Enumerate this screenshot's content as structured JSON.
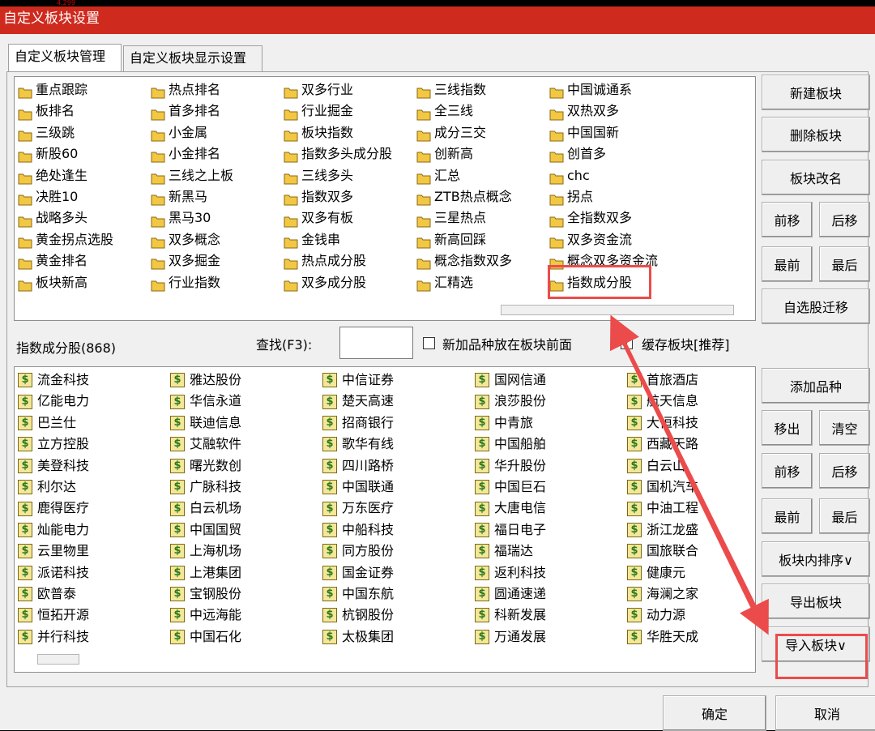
{
  "window": {
    "title": "自定义板块设置",
    "top_readout": "4,299"
  },
  "tabs": [
    {
      "label": "自定义板块管理",
      "active": true
    },
    {
      "label": "自定义板块显示设置",
      "active": false
    }
  ],
  "blocks": {
    "items": [
      "重点跟踪",
      "热点排名",
      "双多行业",
      "三线指数",
      "中国诚通系",
      "板排名",
      "首多排名",
      "行业掘金",
      "全三线",
      "双热双多",
      "三级跳",
      "小金属",
      "板块指数",
      "成分三交",
      "中国国新",
      "新股60",
      "小金排名",
      "指数多头成分股",
      "创新高",
      "创首多",
      "绝处逢生",
      "三线之上板",
      "三线多头",
      "汇总",
      "chc",
      "决胜10",
      "新黑马",
      "指数双多",
      "ZTB热点概念",
      "拐点",
      "战略多头",
      "黑马30",
      "双多有板",
      "三星热点",
      "全指数双多",
      "黄金拐点选股",
      "双多概念",
      "金钱串",
      "新高回踩",
      "双多资金流",
      "黄金排名",
      "双多掘金",
      "热点成分股",
      "概念指数双多",
      "概念双多资金流",
      "板块新高",
      "行业指数",
      "双多成分股",
      "汇精选",
      "指数成分股"
    ],
    "selected": "指数成分股"
  },
  "block_buttons": {
    "new": "新建板块",
    "delete": "删除板块",
    "rename": "板块改名",
    "move_up": "前移",
    "move_down": "后移",
    "first": "最前",
    "last": "最后",
    "migrate": "自选股迁移"
  },
  "middle": {
    "list_title": "指数成分股(868)",
    "search_label": "查找(F3):",
    "search_value": "",
    "prepend_label": "新加品种放在板块前面",
    "prepend_checked": false,
    "cache_label": "缓存板块[推荐]",
    "cache_checked": true
  },
  "stocks": {
    "items": [
      "流金科技",
      "雅达股份",
      "中信证券",
      "国网信通",
      "首旅酒店",
      "亿能电力",
      "华信永道",
      "楚天高速",
      "浪莎股份",
      "航天信息",
      "巴兰仕",
      "联迪信息",
      "招商银行",
      "中青旅",
      "大恒科技",
      "立方控股",
      "艾融软件",
      "歌华有线",
      "中国船舶",
      "西藏天路",
      "美登科技",
      "曙光数创",
      "四川路桥",
      "华升股份",
      "白云山",
      "利尔达",
      "广脉科技",
      "中国联通",
      "中国巨石",
      "国机汽车",
      "鹿得医疗",
      "白云机场",
      "万东医疗",
      "大唐电信",
      "中油工程",
      "灿能电力",
      "中国国贸",
      "中船科技",
      "福日电子",
      "浙江龙盛",
      "云里物里",
      "上海机场",
      "同方股份",
      "福瑞达",
      "国旅联合",
      "派诺科技",
      "上港集团",
      "国金证券",
      "返利科技",
      "健康元",
      "欧普泰",
      "宝钢股份",
      "中国东航",
      "圆通速递",
      "海澜之家",
      "恒拓开源",
      "中远海能",
      "杭钢股份",
      "科新发展",
      "动力源",
      "并行科技",
      "中国石化",
      "太极集团",
      "万通发展",
      "华胜天成"
    ]
  },
  "stock_buttons": {
    "add": "添加品种",
    "remove": "移出",
    "clear": "清空",
    "move_up": "前移",
    "move_down": "后移",
    "first": "最前",
    "last": "最后",
    "sort": "板块内排序∨",
    "export": "导出板块",
    "import": "导入板块∨"
  },
  "dialog_buttons": {
    "ok": "确定",
    "cancel": "取消"
  },
  "icons": {
    "folder": "folder-icon",
    "stock": "stock-icon",
    "stock_glyph": "$"
  },
  "colors": {
    "titlebar": "#cf2a1e",
    "annotation": "#ec4b4b",
    "folder": "#f2c744"
  }
}
